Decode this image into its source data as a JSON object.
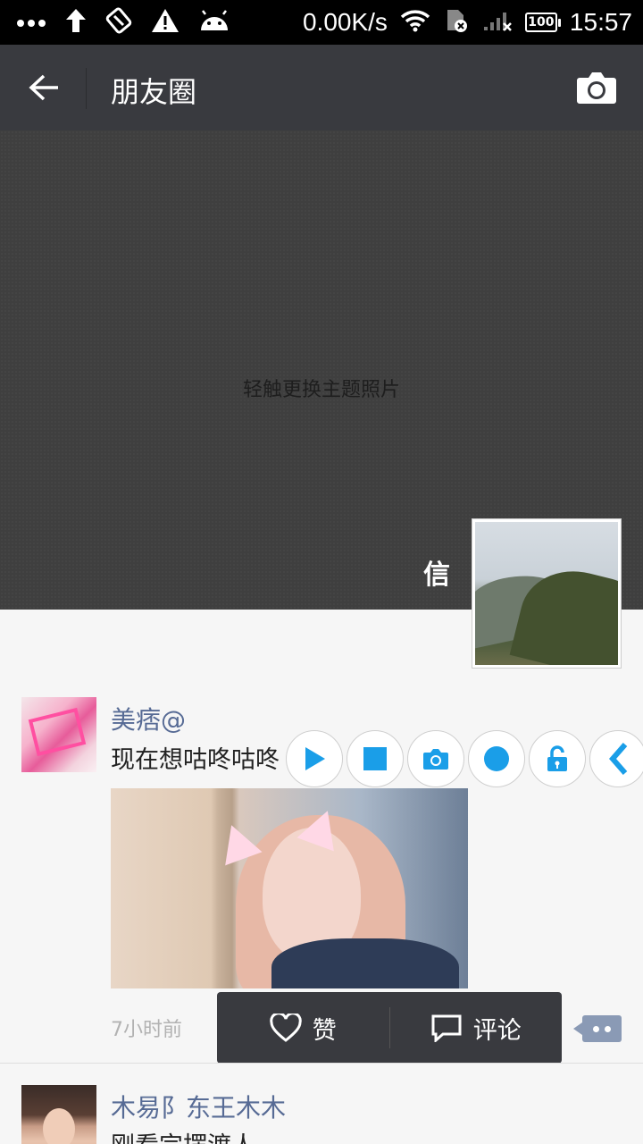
{
  "status_bar": {
    "network_speed": "0.00K/s",
    "battery": "100",
    "time": "15:57"
  },
  "header": {
    "title": "朋友圈"
  },
  "cover": {
    "hint": "轻触更换主题照片",
    "username": "信"
  },
  "posts": [
    {
      "name": "美痞@",
      "text": "现在想咕咚咕咚",
      "time": "7小时前"
    },
    {
      "name": "木易阝东王木木",
      "text": "刚看完摆渡人"
    }
  ],
  "actions": {
    "like": "赞",
    "comment": "评论"
  },
  "colors": {
    "header_bg": "#393a3f",
    "name_link": "#576b95",
    "toolbar_accent": "#1a9ee8"
  },
  "icons": {
    "toolbar": [
      "play-icon",
      "stop-icon",
      "camera-icon",
      "record-icon",
      "unlock-icon",
      "collapse-icon"
    ]
  }
}
